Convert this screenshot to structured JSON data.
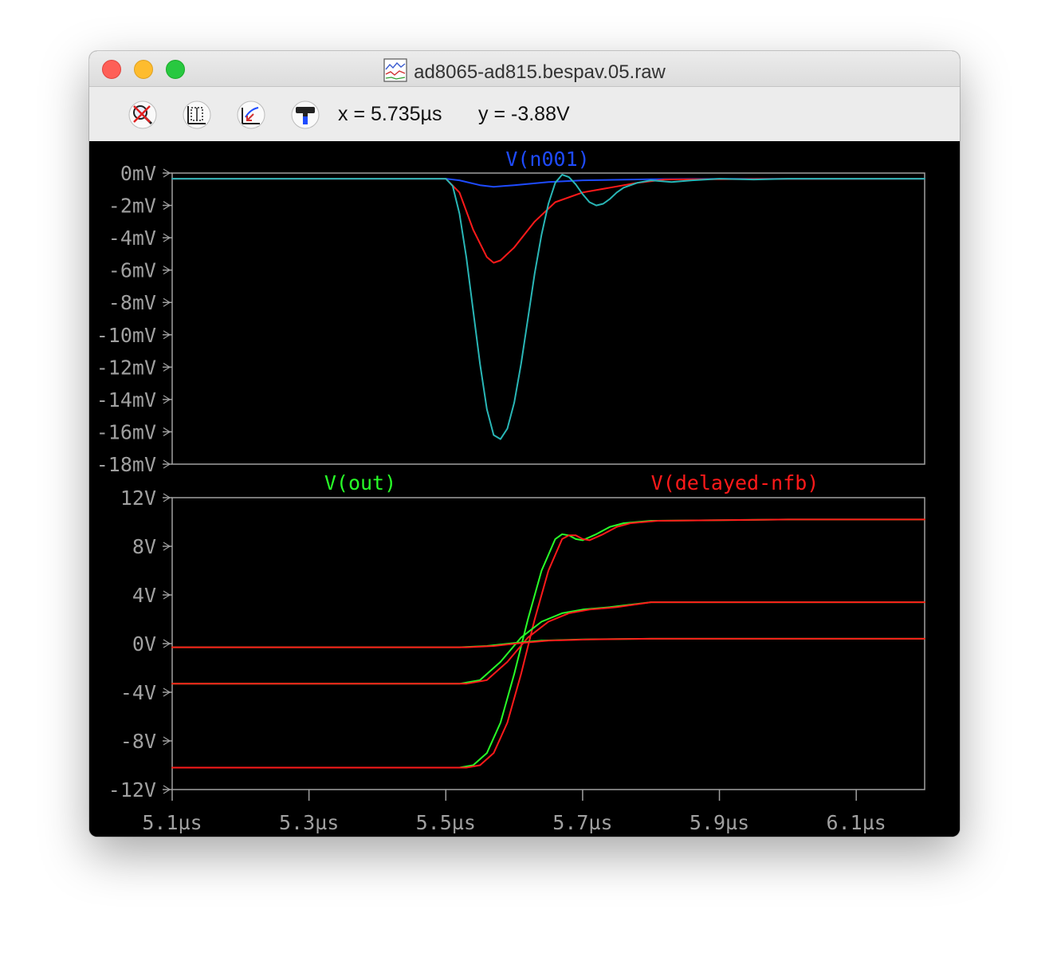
{
  "window": {
    "title": "ad8065-ad815.bespav.05.raw"
  },
  "toolbar": {
    "buttons": [
      {
        "name": "zoom-cancel-button",
        "icon": "zoom-cancel-icon"
      },
      {
        "name": "autorange-button",
        "icon": "autorange-icon"
      },
      {
        "name": "zoom-back-button",
        "icon": "zoom-back-icon"
      },
      {
        "name": "hammer-button",
        "icon": "hammer-icon"
      }
    ],
    "cursor_x": "x = 5.735µs",
    "cursor_y": "y = -3.88V"
  },
  "colors": {
    "background": "#000000",
    "frame": "#a0a0a0",
    "axis_text": "#a0a0a0",
    "blue": "#1e4bff",
    "red": "#ff1a1a",
    "cyan": "#29b6b6",
    "green": "#28ff28"
  },
  "chart_data": [
    {
      "type": "line",
      "legend": [
        {
          "label": "V(n001)",
          "color": "#1e4bff"
        }
      ],
      "xlim": [
        5.1,
        6.2
      ],
      "ylim": [
        -18,
        0
      ],
      "yticks": [
        "0mV",
        "-2mV",
        "-4mV",
        "-6mV",
        "-8mV",
        "-10mV",
        "-12mV",
        "-14mV",
        "-16mV",
        "-18mV"
      ],
      "series": [
        {
          "color": "#1e4bff",
          "x": [
            5.1,
            5.5,
            5.52,
            5.55,
            5.57,
            5.6,
            5.65,
            5.7,
            5.8,
            5.9,
            6.2
          ],
          "y": [
            -0.35,
            -0.35,
            -0.45,
            -0.75,
            -0.85,
            -0.75,
            -0.55,
            -0.45,
            -0.38,
            -0.36,
            -0.35
          ]
        },
        {
          "color": "#ff1a1a",
          "x": [
            5.1,
            5.5,
            5.52,
            5.54,
            5.56,
            5.57,
            5.58,
            5.6,
            5.63,
            5.66,
            5.7,
            5.74,
            5.78,
            5.82,
            5.9,
            6.0,
            6.2
          ],
          "y": [
            -0.35,
            -0.35,
            -1.2,
            -3.5,
            -5.2,
            -5.55,
            -5.4,
            -4.6,
            -3.0,
            -1.8,
            -1.2,
            -0.9,
            -0.6,
            -0.4,
            -0.38,
            -0.36,
            -0.35
          ]
        },
        {
          "color": "#29b6b6",
          "x": [
            5.1,
            5.5,
            5.51,
            5.52,
            5.53,
            5.54,
            5.55,
            5.56,
            5.57,
            5.58,
            5.59,
            5.6,
            5.61,
            5.62,
            5.63,
            5.64,
            5.65,
            5.66,
            5.67,
            5.68,
            5.69,
            5.7,
            5.71,
            5.72,
            5.73,
            5.74,
            5.75,
            5.76,
            5.78,
            5.8,
            5.83,
            5.86,
            5.9,
            5.95,
            6.0,
            6.2
          ],
          "y": [
            -0.35,
            -0.35,
            -0.8,
            -2.5,
            -5.2,
            -8.5,
            -11.8,
            -14.6,
            -16.2,
            -16.45,
            -15.8,
            -14.2,
            -11.8,
            -9.0,
            -6.2,
            -3.8,
            -1.9,
            -0.6,
            -0.1,
            -0.25,
            -0.7,
            -1.3,
            -1.8,
            -2.0,
            -1.9,
            -1.6,
            -1.2,
            -0.9,
            -0.6,
            -0.45,
            -0.55,
            -0.45,
            -0.35,
            -0.4,
            -0.35,
            -0.35
          ]
        }
      ]
    },
    {
      "type": "line",
      "legend": [
        {
          "label": "V(out)",
          "color": "#28ff28"
        },
        {
          "label": "V(delayed-nfb)",
          "color": "#ff1a1a"
        }
      ],
      "xlim": [
        5.1,
        6.2
      ],
      "ylim": [
        -12,
        12
      ],
      "xlabel": "",
      "xticks": [
        "5.1µs",
        "5.3µs",
        "5.5µs",
        "5.7µs",
        "5.9µs",
        "6.1µs"
      ],
      "xtick_values": [
        5.1,
        5.3,
        5.5,
        5.7,
        5.9,
        6.1
      ],
      "yticks": [
        "12V",
        "8V",
        "4V",
        "0V",
        "-4V",
        "-8V",
        "-12V"
      ],
      "series": [
        {
          "color": "#28ff28",
          "x": [
            5.1,
            5.52,
            5.54,
            5.56,
            5.58,
            5.6,
            5.62,
            5.64,
            5.66,
            5.67,
            5.68,
            5.69,
            5.7,
            5.72,
            5.74,
            5.76,
            5.8,
            5.9,
            6.0,
            6.2
          ],
          "y": [
            -10.2,
            -10.2,
            -10.0,
            -9.0,
            -6.5,
            -2.5,
            2.0,
            6.0,
            8.6,
            9.0,
            8.9,
            8.6,
            8.5,
            9.0,
            9.6,
            9.9,
            10.1,
            10.15,
            10.2,
            10.2
          ]
        },
        {
          "color": "#ff1a1a",
          "x": [
            5.1,
            5.53,
            5.55,
            5.57,
            5.59,
            5.61,
            5.63,
            5.65,
            5.67,
            5.68,
            5.69,
            5.7,
            5.71,
            5.73,
            5.75,
            5.77,
            5.81,
            5.9,
            6.0,
            6.2
          ],
          "y": [
            -10.2,
            -10.2,
            -10.0,
            -9.0,
            -6.5,
            -2.5,
            2.0,
            6.0,
            8.6,
            8.9,
            8.9,
            8.6,
            8.5,
            9.0,
            9.6,
            9.9,
            10.1,
            10.15,
            10.2,
            10.2
          ]
        },
        {
          "color": "#28ff28",
          "x": [
            5.1,
            5.52,
            5.55,
            5.58,
            5.61,
            5.64,
            5.67,
            5.7,
            5.74,
            5.8,
            5.9,
            6.2
          ],
          "y": [
            -3.3,
            -3.3,
            -3.0,
            -1.5,
            0.5,
            1.8,
            2.5,
            2.8,
            3.0,
            3.4,
            3.4,
            3.4
          ]
        },
        {
          "color": "#ff1a1a",
          "x": [
            5.1,
            5.53,
            5.56,
            5.59,
            5.62,
            5.65,
            5.68,
            5.71,
            5.75,
            5.8,
            5.9,
            6.2
          ],
          "y": [
            -3.3,
            -3.3,
            -3.0,
            -1.5,
            0.5,
            1.8,
            2.5,
            2.8,
            3.0,
            3.4,
            3.4,
            3.4
          ]
        },
        {
          "color": "#28ff28",
          "x": [
            5.1,
            5.52,
            5.56,
            5.6,
            5.64,
            5.7,
            5.8,
            6.2
          ],
          "y": [
            -0.3,
            -0.3,
            -0.2,
            0.05,
            0.25,
            0.35,
            0.4,
            0.4
          ]
        },
        {
          "color": "#ff1a1a",
          "x": [
            5.1,
            5.53,
            5.57,
            5.61,
            5.65,
            5.71,
            5.8,
            6.2
          ],
          "y": [
            -0.3,
            -0.3,
            -0.2,
            0.05,
            0.25,
            0.35,
            0.4,
            0.4
          ]
        }
      ]
    }
  ]
}
